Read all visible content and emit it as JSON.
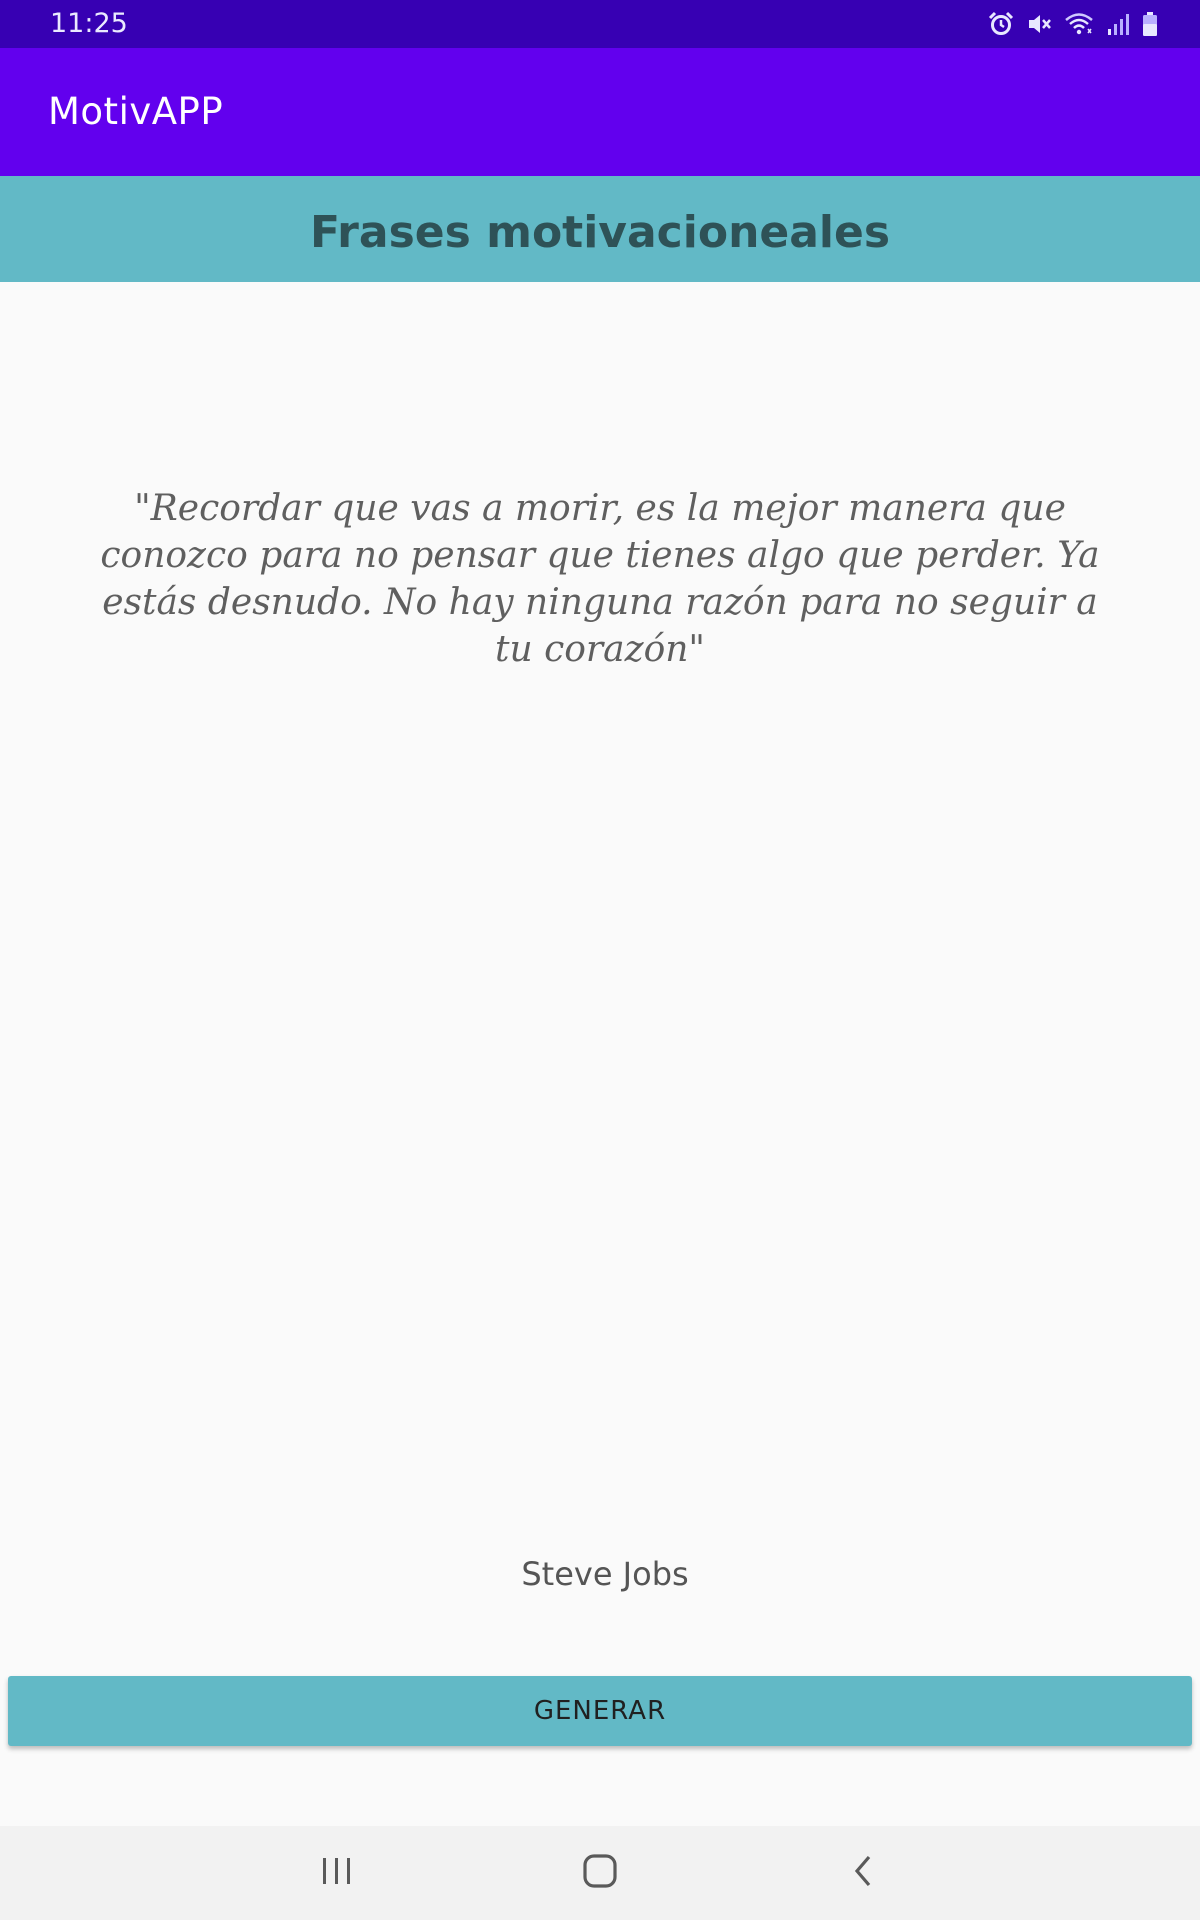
{
  "status_bar": {
    "time": "11:25",
    "icons": [
      "alarm-icon",
      "mute-icon",
      "wifi-icon",
      "signal-icon",
      "battery-icon"
    ]
  },
  "app_bar": {
    "title": "MotivAPP"
  },
  "header": {
    "title": "Frases motivacioneales"
  },
  "quote": {
    "text": "\"Recordar que vas a morir, es la mejor manera que conozco para no pensar que tienes algo que perder. Ya estás desnudo. No hay ninguna razón para no seguir a tu corazón\"",
    "author": "Steve Jobs"
  },
  "button": {
    "label": "GENERAR"
  },
  "nav_bar": {
    "icons": [
      "recent-apps-icon",
      "home-icon",
      "back-icon"
    ]
  },
  "colors": {
    "status_bar": "#3700b3",
    "app_bar": "#6200ee",
    "accent": "#62b9c6",
    "header_text": "#2e5257"
  }
}
